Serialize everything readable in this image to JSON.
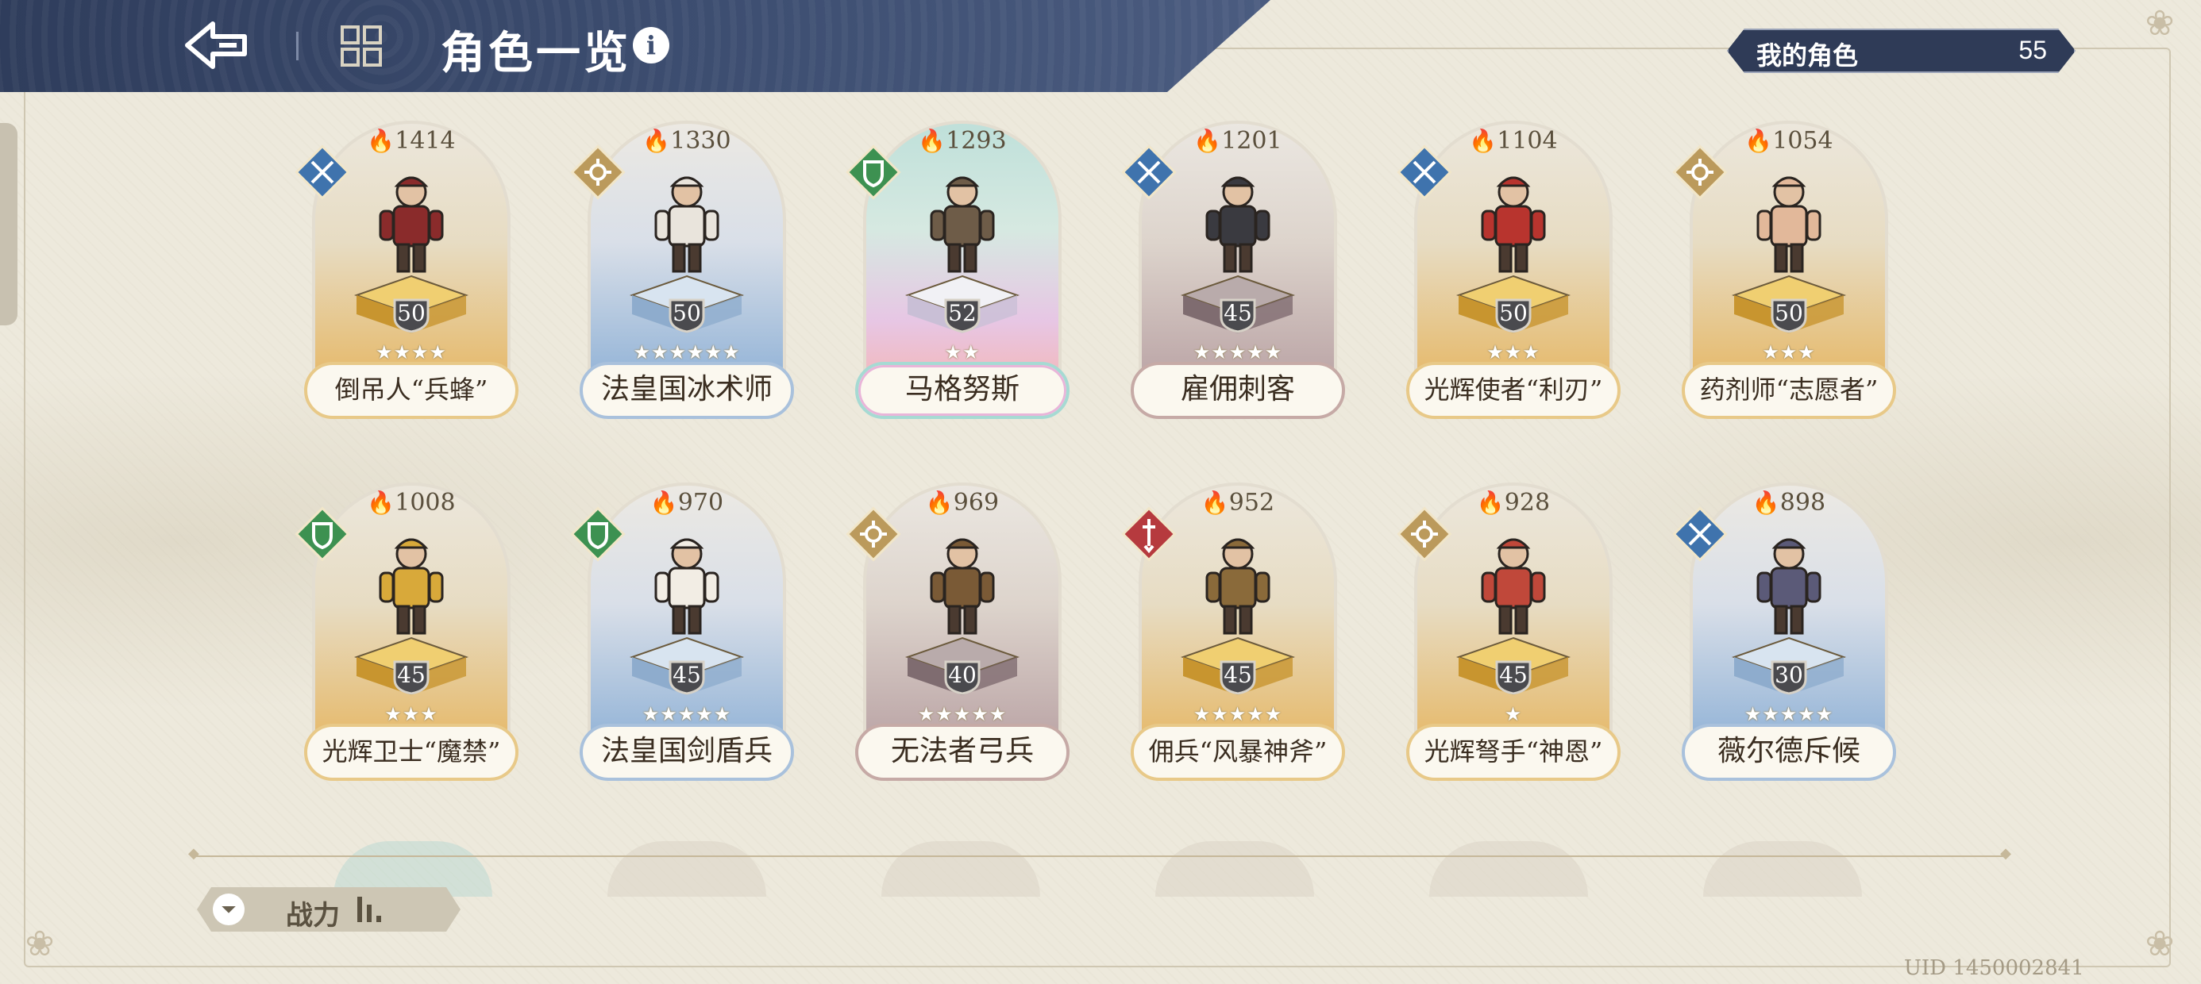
{
  "header": {
    "title": "角色一览",
    "back_icon": "back-arrow-icon",
    "grid_icon": "grid-view-icon",
    "info_icon": "info-icon",
    "info_glyph": "i"
  },
  "my_characters": {
    "label": "我的角色",
    "count": "55"
  },
  "colors": {
    "header_bg": "#3e4f72",
    "class_blue": "#3f73ad",
    "class_gold": "#bb9a5c",
    "class_green": "#3d9151",
    "class_red": "#b63a3e"
  },
  "cards": [
    {
      "power": "1414",
      "level": "50",
      "stars": 4,
      "name": "倒吊人“兵蜂”",
      "class": "blue",
      "theme": "gold"
    },
    {
      "power": "1330",
      "level": "50",
      "stars": 6,
      "name": "法皇国冰术师",
      "class": "gold",
      "theme": "blue"
    },
    {
      "power": "1293",
      "level": "52",
      "stars": 2,
      "name": "马格努斯",
      "class": "green",
      "theme": "rainbow"
    },
    {
      "power": "1201",
      "level": "45",
      "stars": 5,
      "name": "雇佣刺客",
      "class": "blue",
      "theme": "purple"
    },
    {
      "power": "1104",
      "level": "50",
      "stars": 3,
      "name": "光辉使者“利刃”",
      "class": "blue",
      "theme": "gold"
    },
    {
      "power": "1054",
      "level": "50",
      "stars": 3,
      "name": "药剂师“志愿者”",
      "class": "gold",
      "theme": "gold"
    },
    {
      "power": "1008",
      "level": "45",
      "stars": 3,
      "name": "光辉卫士“魔禁”",
      "class": "green",
      "theme": "gold"
    },
    {
      "power": "970",
      "level": "45",
      "stars": 5,
      "name": "法皇国剑盾兵",
      "class": "green",
      "theme": "blue"
    },
    {
      "power": "969",
      "level": "40",
      "stars": 5,
      "name": "无法者弓兵",
      "class": "gold",
      "theme": "purple"
    },
    {
      "power": "952",
      "level": "45",
      "stars": 5,
      "name": "佣兵“风暴神斧”",
      "class": "red",
      "theme": "gold"
    },
    {
      "power": "928",
      "level": "45",
      "stars": 1,
      "name": "光辉弩手“神恩”",
      "class": "gold",
      "theme": "gold"
    },
    {
      "power": "898",
      "level": "30",
      "stars": 5,
      "name": "薇尔德斥候",
      "class": "blue",
      "theme": "blue"
    }
  ],
  "sort": {
    "label": "战力",
    "icon": "filter-icon"
  },
  "uid": "UID 1450002841"
}
